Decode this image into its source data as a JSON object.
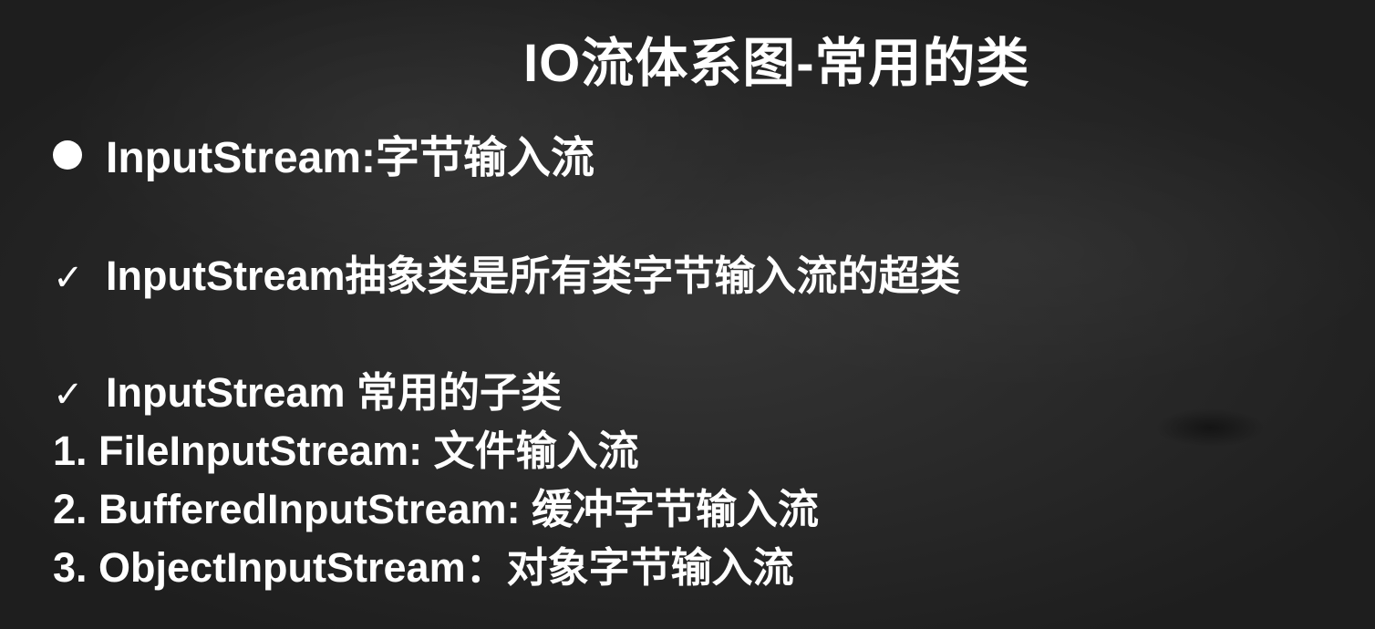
{
  "slide": {
    "title": "IO流体系图-常用的类",
    "heading": "InputStream:字节输入流",
    "check_mark": "✓",
    "points": [
      "InputStream抽象类是所有类字节输入流的超类",
      "InputStream 常用的子类"
    ],
    "subclasses": [
      "1. FileInputStream: 文件输入流",
      "2. BufferedInputStream: 缓冲字节输入流",
      "3. ObjectInputStream：对象字节输入流"
    ]
  }
}
